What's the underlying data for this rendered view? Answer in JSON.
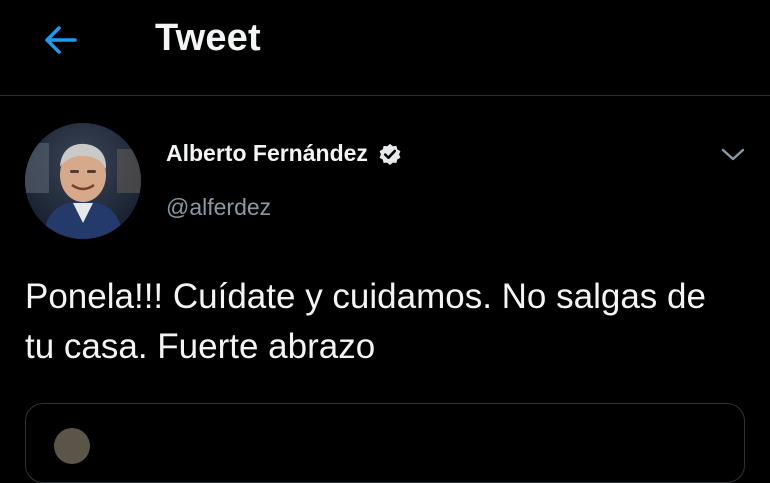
{
  "header": {
    "title": "Tweet",
    "back_icon": "back-arrow-icon",
    "accent_color": "#1d9bf0"
  },
  "tweet": {
    "author_name": "Alberto Fernández",
    "handle": "@alferdez",
    "verified_icon": "verified-badge-icon",
    "menu_icon": "chevron-down-icon",
    "text": "Ponela!!! Cuídate y cuidamos. No salgas de tu casa. Fuerte abrazo"
  }
}
